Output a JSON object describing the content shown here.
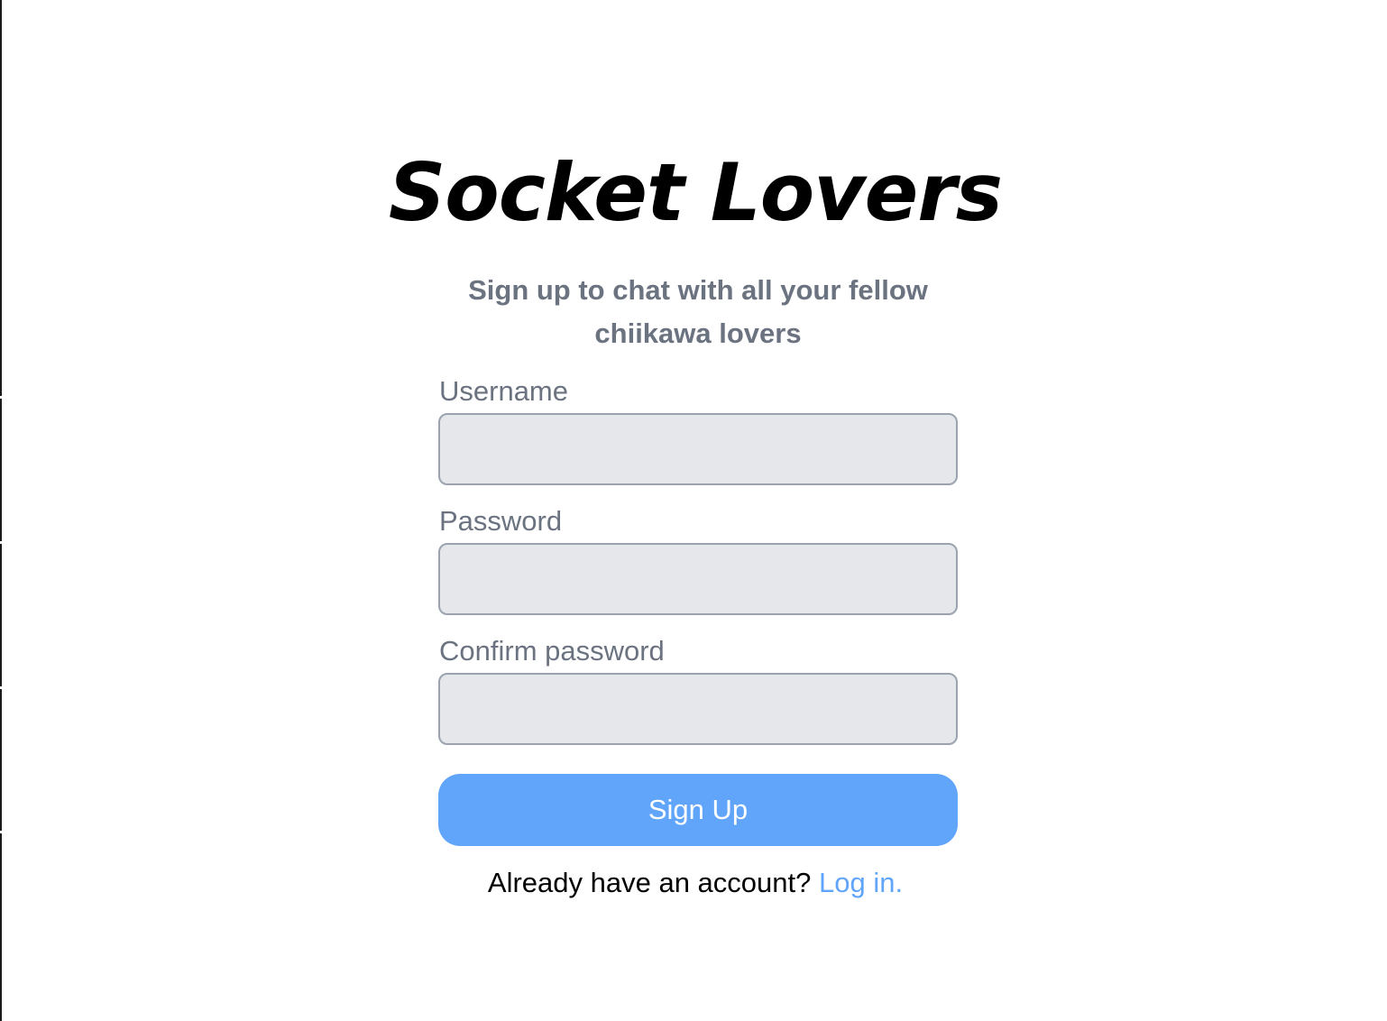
{
  "app": {
    "title": "Socket Lovers",
    "subtitle": "Sign up to chat with all your fellow chiikawa lovers"
  },
  "form": {
    "username": {
      "label": "Username",
      "value": "",
      "placeholder": ""
    },
    "password": {
      "label": "Password",
      "value": "",
      "placeholder": ""
    },
    "confirm_password": {
      "label": "Confirm password",
      "value": "",
      "placeholder": ""
    },
    "submit_label": "Sign Up"
  },
  "footer": {
    "prompt": "Already have an account?",
    "login_link": "Log in."
  },
  "colors": {
    "accent": "#60a5fa",
    "muted_text": "#6b7280",
    "input_background": "#e5e7eb",
    "input_border": "#9ca3af"
  }
}
